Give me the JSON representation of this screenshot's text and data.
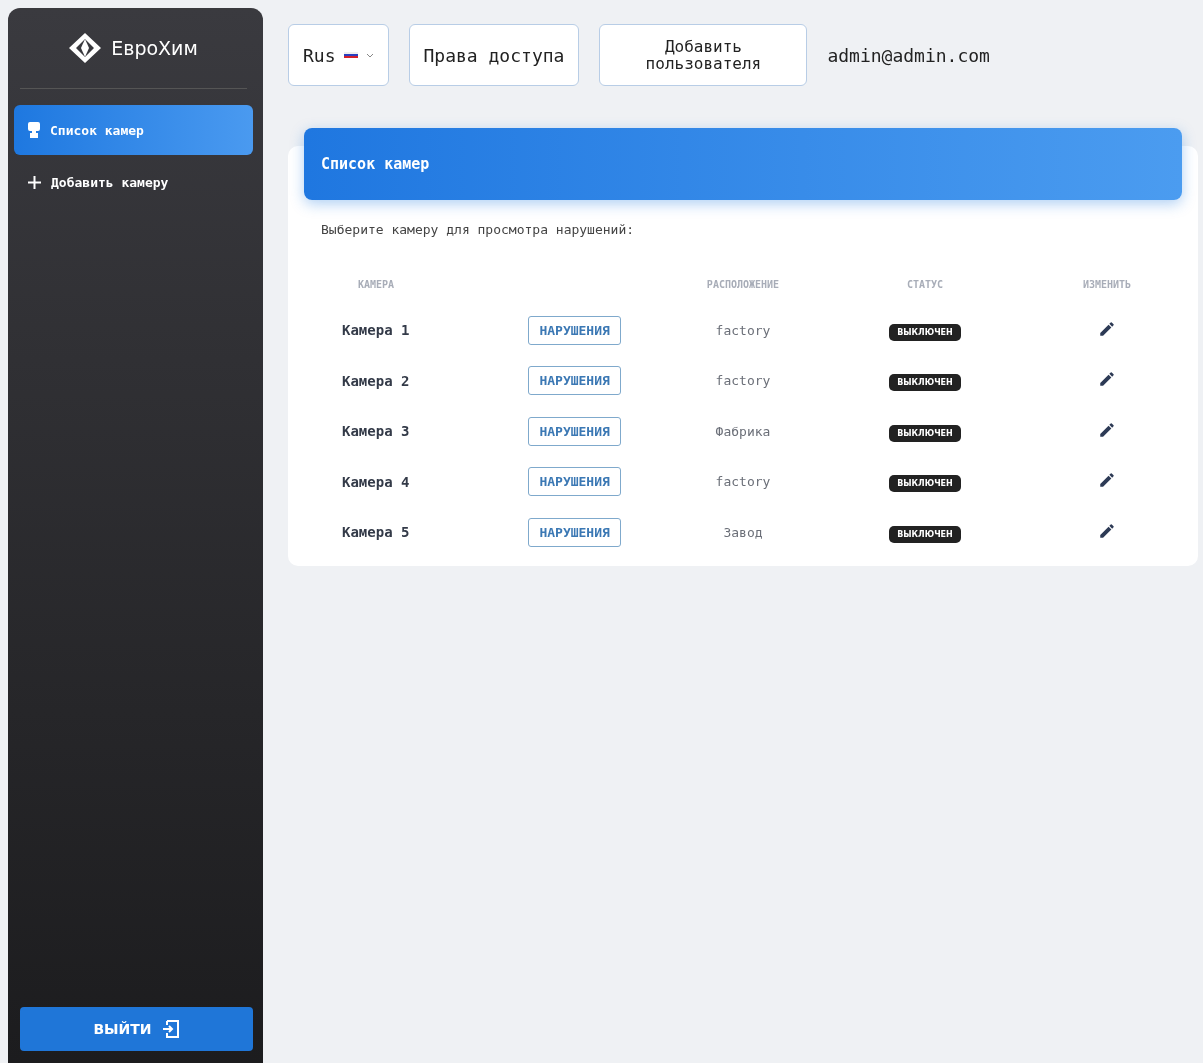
{
  "brand": {
    "name": "ЕвроХим"
  },
  "sidebar": {
    "items": [
      {
        "label": "Список камер",
        "selected": true
      },
      {
        "label": "Добавить камеру",
        "selected": false
      }
    ],
    "logout": "ВЫЙТИ"
  },
  "topbar": {
    "language": "Rus",
    "buttons": [
      "Права доступа",
      "Добавить пользователя"
    ],
    "user": "admin@admin.com"
  },
  "card": {
    "title": "Список камер",
    "subtitle": "Выберите камеру для просмотра нарушений:",
    "table": {
      "columns": [
        "КАМЕРА",
        "",
        "РАСПОЛОЖЕНИЕ",
        "СТАТУС",
        "ИЗМЕНИТЬ"
      ],
      "rows": [
        {
          "name": "Камера 1",
          "action": "НАРУШЕНИЯ",
          "location": "factory",
          "status": "ВЫКЛЮЧЕН"
        },
        {
          "name": "Камера 2",
          "action": "НАРУШЕНИЯ",
          "location": "factory",
          "status": "ВЫКЛЮЧЕН"
        },
        {
          "name": "Камера 3",
          "action": "НАРУШЕНИЯ",
          "location": "Фабрика",
          "status": "ВЫКЛЮЧЕН"
        },
        {
          "name": "Камера 4",
          "action": "НАРУШЕНИЯ",
          "location": "factory",
          "status": "ВЫКЛЮЧЕН"
        },
        {
          "name": "Камера 5",
          "action": "НАРУШЕНИЯ",
          "location": "Завод",
          "status": "ВЫКЛЮЧЕН"
        }
      ]
    }
  }
}
